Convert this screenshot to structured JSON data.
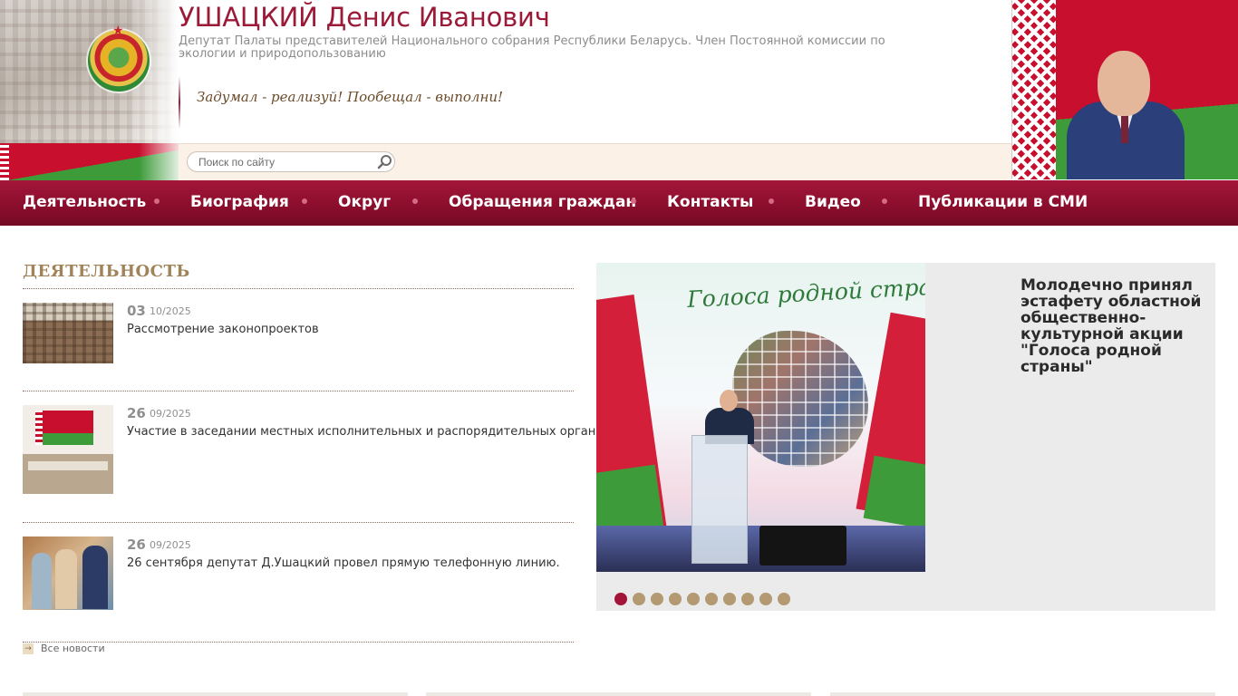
{
  "header": {
    "name": "УШАЦКИЙ Денис Иванович",
    "position": "Депутат Палаты представителей Национального собрания Республики Беларусь. Член Постоянной комиссии по экологии и природопользованию",
    "motto": "Задумал - реализуй! Пообещал - выполни!"
  },
  "search": {
    "placeholder": "Поиск по сайту",
    "icon": "search-icon"
  },
  "nav": {
    "items": [
      {
        "label": "Деятельность"
      },
      {
        "label": "Биография"
      },
      {
        "label": "Округ"
      },
      {
        "label": "Обращения граждан"
      },
      {
        "label": "Контакты"
      },
      {
        "label": "Видео"
      },
      {
        "label": "Публикации в СМИ"
      }
    ]
  },
  "news": {
    "section_title": "ДЕЯТЕЛЬНОСТЬ",
    "items": [
      {
        "day": "03",
        "month": "10/2025",
        "title": "Рассмотрение законопроектов"
      },
      {
        "day": "26",
        "month": "09/2025",
        "title": "Участие в заседании местных исполнительных и распорядительных органов."
      },
      {
        "day": "26",
        "month": "09/2025",
        "title": "26 сентября депутат Д.Ушацкий провел прямую телефонную линию."
      }
    ],
    "all_news_label": "Все новости"
  },
  "slider": {
    "screen_text": "Голоса родной страны",
    "caption": "Молодечно принял эстафету областной общественно-культурной акции \"Голоса родной страны\"",
    "dot_count": 10,
    "active_dot": 1
  },
  "colors": {
    "brand": "#9b1a37",
    "nav_bg": "#8a0d2c",
    "accent_gold": "#a08358",
    "dot_inactive": "#b49a72",
    "dot_active": "#a3163a"
  }
}
